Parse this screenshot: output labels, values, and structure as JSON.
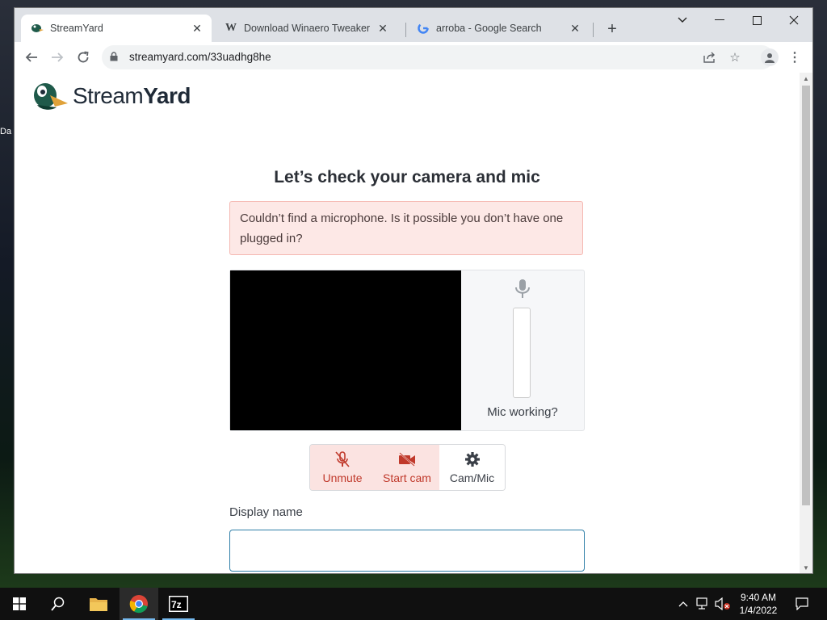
{
  "browser": {
    "tabs": [
      {
        "title": "StreamYard",
        "favicon": "streamyard-duck-icon",
        "active": true
      },
      {
        "title": "Download Winaero Tweaker",
        "favicon": "winaero-w-icon",
        "active": false
      },
      {
        "title": "arroba - Google Search",
        "favicon": "google-g-icon",
        "active": false
      }
    ],
    "url": "streamyard.com/33uadhg8he"
  },
  "page": {
    "logo": {
      "light": "Stream",
      "bold": "Yard"
    },
    "heading": "Let’s check your camera and mic",
    "alert": "Couldn’t find a microphone. Is it possible you don’t have one plugged in?",
    "mic_status_label": "Mic working?",
    "controls": [
      {
        "label": "Unmute",
        "icon": "mic-off-icon"
      },
      {
        "label": "Start cam",
        "icon": "camera-off-icon"
      },
      {
        "label": "Cam/Mic",
        "icon": "gear-icon"
      }
    ],
    "display_name": {
      "label": "Display name",
      "value": "",
      "placeholder": ""
    }
  },
  "desktop": {
    "left_fragment": "Da"
  },
  "taskbar": {
    "apps": [
      "start-icon",
      "search-icon",
      "file-explorer-icon",
      "chrome-icon",
      "7zip-icon"
    ],
    "clock": {
      "time": "9:40 AM",
      "date": "1/4/2022"
    }
  },
  "colors": {
    "alert_bg": "#fde8e6",
    "control_red": "#c0392b",
    "input_focus": "#2f7fa8"
  }
}
